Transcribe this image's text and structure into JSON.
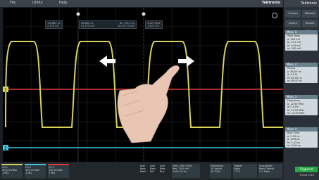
{
  "menu": {
    "items": [
      {
        "label": "File"
      },
      {
        "label": "Utility"
      },
      {
        "label": "Help"
      }
    ],
    "brand": "Tektronix"
  },
  "cursor_readouts": {
    "left": [
      "-58.860 ns",
      "2.375 mV"
    ],
    "middle": [
      "98.860 ns",
      "41.575 mV",
      "Δt: 178.0 ns",
      "Δv: 50.70 mV"
    ],
    "right": [
      "5.620 MHz",
      "1.920 V/s"
    ]
  },
  "sidebar": {
    "top_buttons": [
      "Cursors",
      "Measure",
      "Search",
      "Results Table"
    ],
    "panels": [
      {
        "title": "Meas 1",
        "lines": [
          "Peak-Peak",
          "μ: 204 mV",
          "σ: 3.91 mV",
          "M: 204 mV",
          "m: 200 mV"
        ]
      },
      {
        "title": "Meas 2",
        "lines": [
          "Period",
          "μ: 80.00 ns",
          "σ: 0.0 fs",
          "M: 80.00 ns",
          "m: 80.00 ns"
        ]
      },
      {
        "title": "Meas 3",
        "lines": [
          "Frequency",
          "μ: 12.50 MHz",
          "σ: 0.0 Hz",
          "M: 12.50 MHz",
          "m: 12.50 MHz"
        ]
      },
      {
        "title": "Meas 4",
        "lines": [
          "Rise Time",
          "μ: 5.30 ns",
          "σ: 45.6 ps",
          "M: 5.43 ns",
          "m: 5.16 ns"
        ]
      }
    ],
    "badge": "Triggered",
    "timestamp": "6 Aug 2015"
  },
  "bottom": {
    "channels": [
      {
        "name": "Ch 1",
        "lines": [
          "50.0 mV/div",
          "1 MΩ"
        ],
        "color": "#e8e35a"
      },
      {
        "name": "Ch 2",
        "lines": [
          "100 mV/div",
          "1 MΩ"
        ],
        "color": "#4fc3f7"
      },
      {
        "name": "Ch 3",
        "lines": [
          "100 mV/div",
          "1 MΩ"
        ],
        "color": "#ff5252"
      }
    ],
    "add_buttons": [
      "Add New Math",
      "Add New Ref",
      "Add New Bus"
    ],
    "trigger": {
      "lines": [
        "Trigger",
        "Edge",
        "1.0 V"
      ]
    },
    "acquisition": {
      "lines": [
        "Acquisition",
        "Peak Detect",
        "2.0 Mpts"
      ]
    },
    "horizontal": {
      "lines": [
        "Horizontal",
        "20 ns/div",
        "40 GS/s"
      ]
    },
    "timebase": {
      "lines": [
        "Freq. 250.0 kHz",
        "Res. 25.0 mV",
        "Hold: 20 ns"
      ]
    }
  },
  "labels": {
    "ch1_marker": "1",
    "ch2_marker": "2"
  },
  "colors": {
    "ch1": "#d8d25a",
    "ch2": "#3ec8e0",
    "ch3": "#e03a3a",
    "badge": "#27a745"
  }
}
